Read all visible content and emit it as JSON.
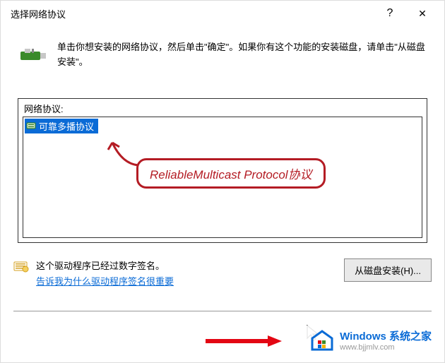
{
  "titlebar": {
    "title": "选择网络协议",
    "help": "?",
    "close": "✕"
  },
  "instruction": "单击你想安装的网络协议，然后单击\"确定\"。如果你有这个功能的安装磁盘，请单击\"从磁盘安装\"。",
  "list": {
    "label": "网络协议:",
    "selected": "可靠多播协议"
  },
  "annotation": "ReliableMulticast Protocol协议",
  "signature": {
    "text": "这个驱动程序已经过数字签名。",
    "link": "告诉我为什么驱动程序签名很重要"
  },
  "disk_button": "从磁盘安装(H)...",
  "watermark": {
    "title": "Windows 系统之家",
    "url": "www.bjjmlv.com"
  }
}
